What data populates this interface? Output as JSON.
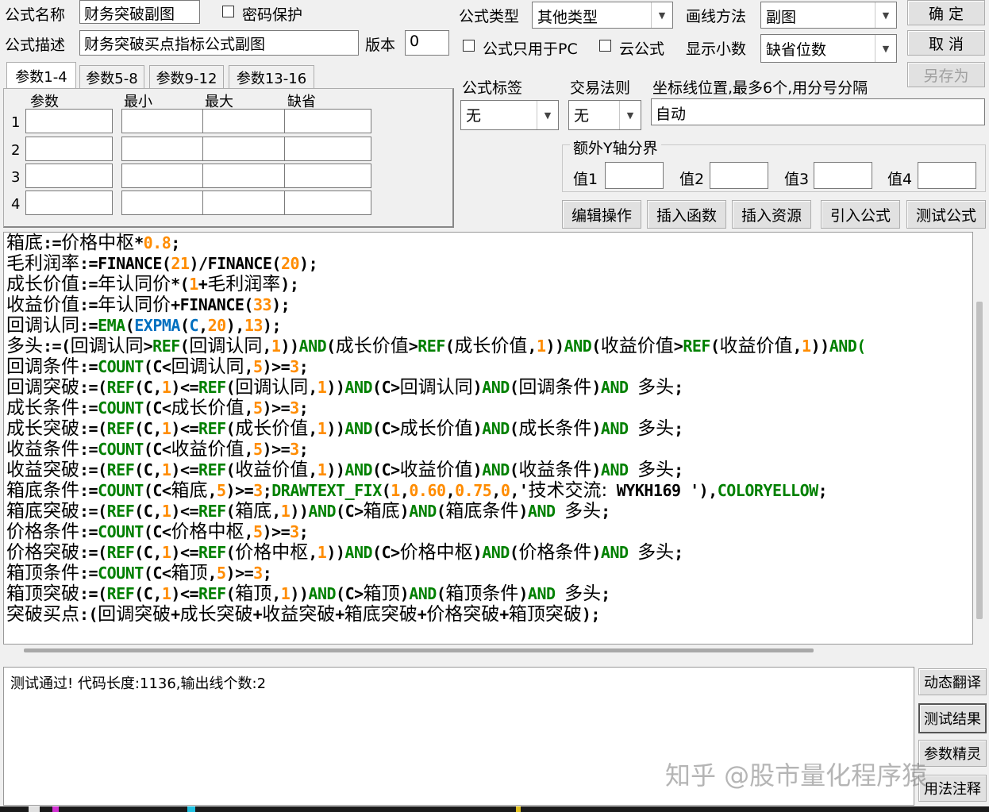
{
  "formula_name": {
    "label": "公式名称",
    "value": "财务突破副图"
  },
  "password": {
    "label": "密码保护"
  },
  "formula_desc": {
    "label": "公式描述",
    "value": "财务突破买点指标公式副图"
  },
  "version": {
    "label": "版本",
    "value": "0"
  },
  "formula_type": {
    "label": "公式类型",
    "value": "其他类型"
  },
  "draw_method": {
    "label": "画线方法",
    "value": "副图"
  },
  "pc_only": {
    "label": "公式只用于PC"
  },
  "cloud": {
    "label": "云公式"
  },
  "decimals": {
    "label": "显示小数",
    "value": "缺省位数"
  },
  "buttons": {
    "ok": "确  定",
    "cancel": "取  消",
    "save_as": "另存为"
  },
  "tag": {
    "label": "公式标签",
    "value": "无"
  },
  "trade_rule": {
    "label": "交易法则",
    "value": "无"
  },
  "axis": {
    "label": "坐标线位置,最多6个,用分号分隔",
    "value": "自动"
  },
  "y_axis": {
    "legend": "额外Y轴分界",
    "v1": "值1",
    "v2": "值2",
    "v3": "值3",
    "v4": "值4"
  },
  "tabs": [
    "参数1-4",
    "参数5-8",
    "参数9-12",
    "参数13-16"
  ],
  "param_headers": [
    "参数",
    "最小",
    "最大",
    "缺省"
  ],
  "param_rows": [
    "1",
    "2",
    "3",
    "4"
  ],
  "tools": [
    "编辑操作",
    "插入函数",
    "插入资源",
    "引入公式",
    "测试公式"
  ],
  "code_lines": [
    [
      [
        "v",
        "箱底"
      ],
      [
        "op",
        ":="
      ],
      [
        "v",
        "价格中枢"
      ],
      [
        "op",
        "*"
      ],
      [
        "num",
        "0.8"
      ],
      [
        "op",
        ";"
      ]
    ],
    [
      [
        "v",
        "毛利润率"
      ],
      [
        "op",
        ":=FINANCE("
      ],
      [
        "num",
        "21"
      ],
      [
        "op",
        ")/FINANCE("
      ],
      [
        "num",
        "20"
      ],
      [
        "op",
        ");"
      ]
    ],
    [
      [
        "v",
        "成长价值"
      ],
      [
        "op",
        ":="
      ],
      [
        "v",
        "年认同价"
      ],
      [
        "op",
        "*("
      ],
      [
        "num",
        "1"
      ],
      [
        "op",
        "+"
      ],
      [
        "v",
        "毛利润率"
      ],
      [
        "op",
        ");"
      ]
    ],
    [
      [
        "v",
        "收益价值"
      ],
      [
        "op",
        ":="
      ],
      [
        "v",
        "年认同价"
      ],
      [
        "op",
        "+FINANCE("
      ],
      [
        "num",
        "33"
      ],
      [
        "op",
        ");"
      ]
    ],
    [
      [
        "v",
        "回调认同"
      ],
      [
        "op",
        ":="
      ],
      [
        "fn",
        "EMA"
      ],
      [
        "op",
        "("
      ],
      [
        "exp",
        "EXPMA"
      ],
      [
        "op",
        "("
      ],
      [
        "exp",
        "C"
      ],
      [
        "op",
        ","
      ],
      [
        "num",
        "20"
      ],
      [
        "op",
        "),"
      ],
      [
        "num",
        "13"
      ],
      [
        "op",
        ");"
      ]
    ],
    [
      [
        "v",
        "多头"
      ],
      [
        "op",
        ":=("
      ],
      [
        "v",
        "回调认同"
      ],
      [
        "op",
        ">"
      ],
      [
        "fn",
        "REF"
      ],
      [
        "op",
        "("
      ],
      [
        "v",
        "回调认同"
      ],
      [
        "op",
        ","
      ],
      [
        "num",
        "1"
      ],
      [
        "op",
        "))"
      ],
      [
        "fn",
        "AND"
      ],
      [
        "op",
        "("
      ],
      [
        "v",
        "成长价值"
      ],
      [
        "op",
        ">"
      ],
      [
        "fn",
        "REF"
      ],
      [
        "op",
        "("
      ],
      [
        "v",
        "成长价值"
      ],
      [
        "op",
        ","
      ],
      [
        "num",
        "1"
      ],
      [
        "op",
        "))"
      ],
      [
        "fn",
        "AND"
      ],
      [
        "op",
        "("
      ],
      [
        "v",
        "收益价值"
      ],
      [
        "op",
        ">"
      ],
      [
        "fn",
        "REF"
      ],
      [
        "op",
        "("
      ],
      [
        "v",
        "收益价值"
      ],
      [
        "op",
        ","
      ],
      [
        "num",
        "1"
      ],
      [
        "op",
        "))"
      ],
      [
        "fn",
        "AND("
      ]
    ],
    [
      [
        "v",
        "回调条件"
      ],
      [
        "op",
        ":="
      ],
      [
        "fn",
        "COUNT"
      ],
      [
        "op",
        "(C<"
      ],
      [
        "v",
        "回调认同"
      ],
      [
        "op",
        ","
      ],
      [
        "num",
        "5"
      ],
      [
        "op",
        ")>="
      ],
      [
        "num",
        "3"
      ],
      [
        "op",
        ";"
      ]
    ],
    [
      [
        "v",
        "回调突破"
      ],
      [
        "op",
        ":=("
      ],
      [
        "fn",
        "REF"
      ],
      [
        "op",
        "(C,"
      ],
      [
        "num",
        "1"
      ],
      [
        "op",
        ")<="
      ],
      [
        "fn",
        "REF"
      ],
      [
        "op",
        "("
      ],
      [
        "v",
        "回调认同"
      ],
      [
        "op",
        ","
      ],
      [
        "num",
        "1"
      ],
      [
        "op",
        "))"
      ],
      [
        "fn",
        "AND"
      ],
      [
        "op",
        "(C>"
      ],
      [
        "v",
        "回调认同"
      ],
      [
        "op",
        ")"
      ],
      [
        "fn",
        "AND"
      ],
      [
        "op",
        "("
      ],
      [
        "v",
        "回调条件"
      ],
      [
        "op",
        ")"
      ],
      [
        "fn",
        "AND "
      ],
      [
        "v",
        "多头"
      ],
      [
        "op",
        ";"
      ]
    ],
    [
      [
        "v",
        "成长条件"
      ],
      [
        "op",
        ":="
      ],
      [
        "fn",
        "COUNT"
      ],
      [
        "op",
        "(C<"
      ],
      [
        "v",
        "成长价值"
      ],
      [
        "op",
        ","
      ],
      [
        "num",
        "5"
      ],
      [
        "op",
        ")>="
      ],
      [
        "num",
        "3"
      ],
      [
        "op",
        ";"
      ]
    ],
    [
      [
        "v",
        "成长突破"
      ],
      [
        "op",
        ":=("
      ],
      [
        "fn",
        "REF"
      ],
      [
        "op",
        "(C,"
      ],
      [
        "num",
        "1"
      ],
      [
        "op",
        ")<="
      ],
      [
        "fn",
        "REF"
      ],
      [
        "op",
        "("
      ],
      [
        "v",
        "成长价值"
      ],
      [
        "op",
        ","
      ],
      [
        "num",
        "1"
      ],
      [
        "op",
        "))"
      ],
      [
        "fn",
        "AND"
      ],
      [
        "op",
        "(C>"
      ],
      [
        "v",
        "成长价值"
      ],
      [
        "op",
        ")"
      ],
      [
        "fn",
        "AND"
      ],
      [
        "op",
        "("
      ],
      [
        "v",
        "成长条件"
      ],
      [
        "op",
        ")"
      ],
      [
        "fn",
        "AND "
      ],
      [
        "v",
        "多头"
      ],
      [
        "op",
        ";"
      ]
    ],
    [
      [
        "v",
        "收益条件"
      ],
      [
        "op",
        ":="
      ],
      [
        "fn",
        "COUNT"
      ],
      [
        "op",
        "(C<"
      ],
      [
        "v",
        "收益价值"
      ],
      [
        "op",
        ","
      ],
      [
        "num",
        "5"
      ],
      [
        "op",
        ")>="
      ],
      [
        "num",
        "3"
      ],
      [
        "op",
        ";"
      ]
    ],
    [
      [
        "v",
        "收益突破"
      ],
      [
        "op",
        ":=("
      ],
      [
        "fn",
        "REF"
      ],
      [
        "op",
        "(C,"
      ],
      [
        "num",
        "1"
      ],
      [
        "op",
        ")<="
      ],
      [
        "fn",
        "REF"
      ],
      [
        "op",
        "("
      ],
      [
        "v",
        "收益价值"
      ],
      [
        "op",
        ","
      ],
      [
        "num",
        "1"
      ],
      [
        "op",
        "))"
      ],
      [
        "fn",
        "AND"
      ],
      [
        "op",
        "(C>"
      ],
      [
        "v",
        "收益价值"
      ],
      [
        "op",
        ")"
      ],
      [
        "fn",
        "AND"
      ],
      [
        "op",
        "("
      ],
      [
        "v",
        "收益条件"
      ],
      [
        "op",
        ")"
      ],
      [
        "fn",
        "AND "
      ],
      [
        "v",
        "多头"
      ],
      [
        "op",
        ";"
      ]
    ],
    [
      [
        "v",
        "箱底条件"
      ],
      [
        "op",
        ":="
      ],
      [
        "fn",
        "COUNT"
      ],
      [
        "op",
        "(C<"
      ],
      [
        "v",
        "箱底"
      ],
      [
        "op",
        ","
      ],
      [
        "num",
        "5"
      ],
      [
        "op",
        ")>="
      ],
      [
        "num",
        "3"
      ],
      [
        "op",
        ";"
      ],
      [
        "fn",
        "DRAWTEXT_FIX"
      ],
      [
        "op",
        "("
      ],
      [
        "num",
        "1"
      ],
      [
        "op",
        ","
      ],
      [
        "num",
        "0.60"
      ],
      [
        "op",
        ","
      ],
      [
        "num",
        "0.75"
      ],
      [
        "op",
        ","
      ],
      [
        "num",
        "0"
      ],
      [
        "op",
        ",'"
      ],
      [
        "v",
        "技术交流:"
      ],
      [
        "op",
        " WYKH169 '),"
      ],
      [
        "fn",
        "COLORYELLOW"
      ],
      [
        "op",
        ";"
      ]
    ],
    [
      [
        "v",
        "箱底突破"
      ],
      [
        "op",
        ":=("
      ],
      [
        "fn",
        "REF"
      ],
      [
        "op",
        "(C,"
      ],
      [
        "num",
        "1"
      ],
      [
        "op",
        ")<="
      ],
      [
        "fn",
        "REF"
      ],
      [
        "op",
        "("
      ],
      [
        "v",
        "箱底"
      ],
      [
        "op",
        ","
      ],
      [
        "num",
        "1"
      ],
      [
        "op",
        "))"
      ],
      [
        "fn",
        "AND"
      ],
      [
        "op",
        "(C>"
      ],
      [
        "v",
        "箱底"
      ],
      [
        "op",
        ")"
      ],
      [
        "fn",
        "AND"
      ],
      [
        "op",
        "("
      ],
      [
        "v",
        "箱底条件"
      ],
      [
        "op",
        ")"
      ],
      [
        "fn",
        "AND "
      ],
      [
        "v",
        "多头"
      ],
      [
        "op",
        ";"
      ]
    ],
    [
      [
        "v",
        "价格条件"
      ],
      [
        "op",
        ":="
      ],
      [
        "fn",
        "COUNT"
      ],
      [
        "op",
        "(C<"
      ],
      [
        "v",
        "价格中枢"
      ],
      [
        "op",
        ","
      ],
      [
        "num",
        "5"
      ],
      [
        "op",
        ")>="
      ],
      [
        "num",
        "3"
      ],
      [
        "op",
        ";"
      ]
    ],
    [
      [
        "v",
        "价格突破"
      ],
      [
        "op",
        ":=("
      ],
      [
        "fn",
        "REF"
      ],
      [
        "op",
        "(C,"
      ],
      [
        "num",
        "1"
      ],
      [
        "op",
        ")<="
      ],
      [
        "fn",
        "REF"
      ],
      [
        "op",
        "("
      ],
      [
        "v",
        "价格中枢"
      ],
      [
        "op",
        ","
      ],
      [
        "num",
        "1"
      ],
      [
        "op",
        "))"
      ],
      [
        "fn",
        "AND"
      ],
      [
        "op",
        "(C>"
      ],
      [
        "v",
        "价格中枢"
      ],
      [
        "op",
        ")"
      ],
      [
        "fn",
        "AND"
      ],
      [
        "op",
        "("
      ],
      [
        "v",
        "价格条件"
      ],
      [
        "op",
        ")"
      ],
      [
        "fn",
        "AND "
      ],
      [
        "v",
        "多头"
      ],
      [
        "op",
        ";"
      ]
    ],
    [
      [
        "v",
        "箱顶条件"
      ],
      [
        "op",
        ":="
      ],
      [
        "fn",
        "COUNT"
      ],
      [
        "op",
        "(C<"
      ],
      [
        "v",
        "箱顶"
      ],
      [
        "op",
        ","
      ],
      [
        "num",
        "5"
      ],
      [
        "op",
        ")>="
      ],
      [
        "num",
        "3"
      ],
      [
        "op",
        ";"
      ]
    ],
    [
      [
        "v",
        "箱顶突破"
      ],
      [
        "op",
        ":=("
      ],
      [
        "fn",
        "REF"
      ],
      [
        "op",
        "(C,"
      ],
      [
        "num",
        "1"
      ],
      [
        "op",
        ")<="
      ],
      [
        "fn",
        "REF"
      ],
      [
        "op",
        "("
      ],
      [
        "v",
        "箱顶"
      ],
      [
        "op",
        ","
      ],
      [
        "num",
        "1"
      ],
      [
        "op",
        "))"
      ],
      [
        "fn",
        "AND"
      ],
      [
        "op",
        "(C>"
      ],
      [
        "v",
        "箱顶"
      ],
      [
        "op",
        ")"
      ],
      [
        "fn",
        "AND"
      ],
      [
        "op",
        "("
      ],
      [
        "v",
        "箱顶条件"
      ],
      [
        "op",
        ")"
      ],
      [
        "fn",
        "AND "
      ],
      [
        "v",
        "多头"
      ],
      [
        "op",
        ";"
      ]
    ],
    [
      [
        "v",
        "突破买点"
      ],
      [
        "op",
        ":("
      ],
      [
        "v",
        "回调突破"
      ],
      [
        "op",
        "+"
      ],
      [
        "v",
        "成长突破"
      ],
      [
        "op",
        "+"
      ],
      [
        "v",
        "收益突破"
      ],
      [
        "op",
        "+"
      ],
      [
        "v",
        "箱底突破"
      ],
      [
        "op",
        "+"
      ],
      [
        "v",
        "价格突破"
      ],
      [
        "op",
        "+"
      ],
      [
        "v",
        "箱顶突破"
      ],
      [
        "op",
        ");"
      ]
    ]
  ],
  "output_text": "测试通过! 代码长度:1136,输出线个数:2",
  "side_buttons": [
    "动态翻译",
    "测试结果",
    "参数精灵",
    "用法注释"
  ],
  "watermark": "知乎 @股市量化程序猿"
}
